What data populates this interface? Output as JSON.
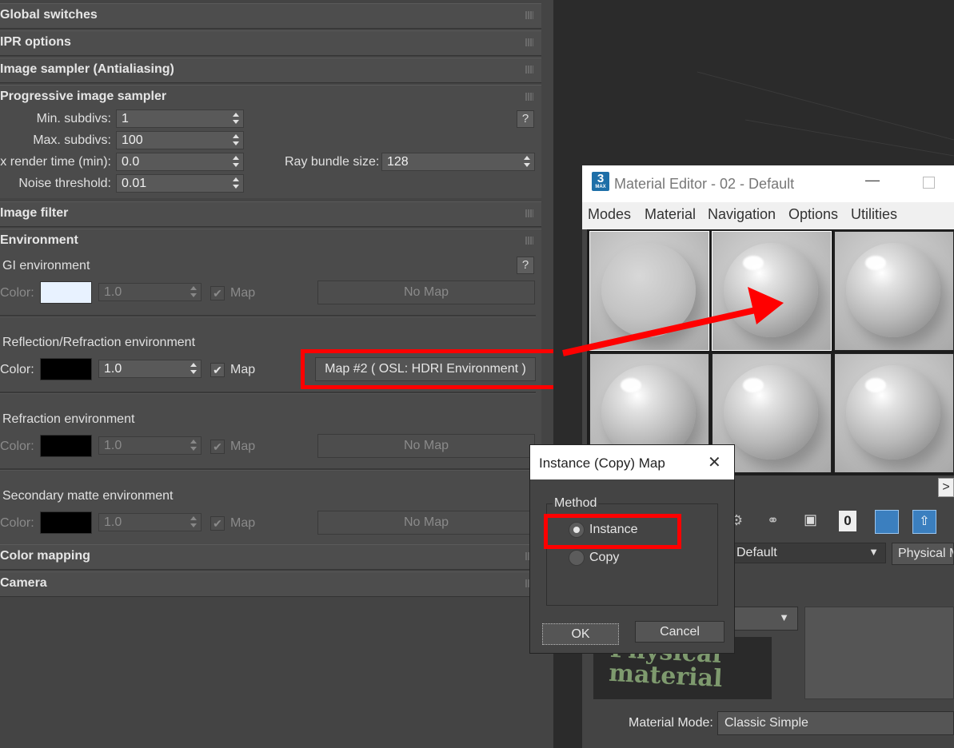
{
  "render_setup": {
    "rollouts": {
      "global_switches": "Global switches",
      "ipr_options": "IPR options",
      "image_sampler": "Image sampler (Antialiasing)",
      "progressive": "Progressive image sampler",
      "image_filter": "Image filter",
      "environment": "Environment",
      "color_mapping": "Color mapping",
      "camera": "Camera"
    },
    "progressive": {
      "min_subdivs_label": "Min. subdivs:",
      "min_subdivs_value": "1",
      "max_subdivs_label": "Max. subdivs:",
      "max_subdivs_value": "100",
      "render_time_label": "x render time (min):",
      "render_time_value": "0.0",
      "ray_bundle_label": "Ray bundle size:",
      "ray_bundle_value": "128",
      "noise_threshold_label": "Noise threshold:",
      "noise_threshold_value": "0.01",
      "help": "?"
    },
    "environment": {
      "help": "?",
      "color_label": "Color:",
      "map_label": "Map",
      "gi": {
        "title": "GI environment",
        "multiplier": "1.0",
        "map_button": "No Map",
        "swatch_color": "#e8f2ff"
      },
      "reflection": {
        "title": "Reflection/Refraction environment",
        "multiplier": "1.0",
        "map_button": "Map #2  ( OSL: HDRI Environment )",
        "swatch_color": "#000000"
      },
      "refraction": {
        "title": "Refraction environment",
        "multiplier": "1.0",
        "map_button": "No Map",
        "swatch_color": "#000000"
      },
      "secondary": {
        "title": "Secondary matte environment",
        "multiplier": "1.0",
        "map_button": "No Map",
        "swatch_color": "#000000"
      }
    }
  },
  "material_editor": {
    "app_icon": "3",
    "app_icon_sub": "MAX",
    "title": "Material Editor - 02 - Default",
    "minimize_icon": "—",
    "menus": [
      "Modes",
      "Material",
      "Navigation",
      "Options",
      "Utilities"
    ],
    "toolbar_zero": "0",
    "material_name": "Default",
    "material_type": "Physical M",
    "logo_text": "Physical material",
    "material_mode_label": "Material Mode:",
    "material_mode_value": "Classic Simple",
    "scroll_arrow": ">"
  },
  "dialog": {
    "title": "Instance (Copy) Map",
    "close_icon": "✕",
    "group_label": "Method",
    "options": [
      "Instance",
      "Copy"
    ],
    "selected": "Instance",
    "ok": "OK",
    "cancel": "Cancel"
  },
  "colors": {
    "highlight": "#ff0000",
    "panel_bg": "#444444"
  }
}
